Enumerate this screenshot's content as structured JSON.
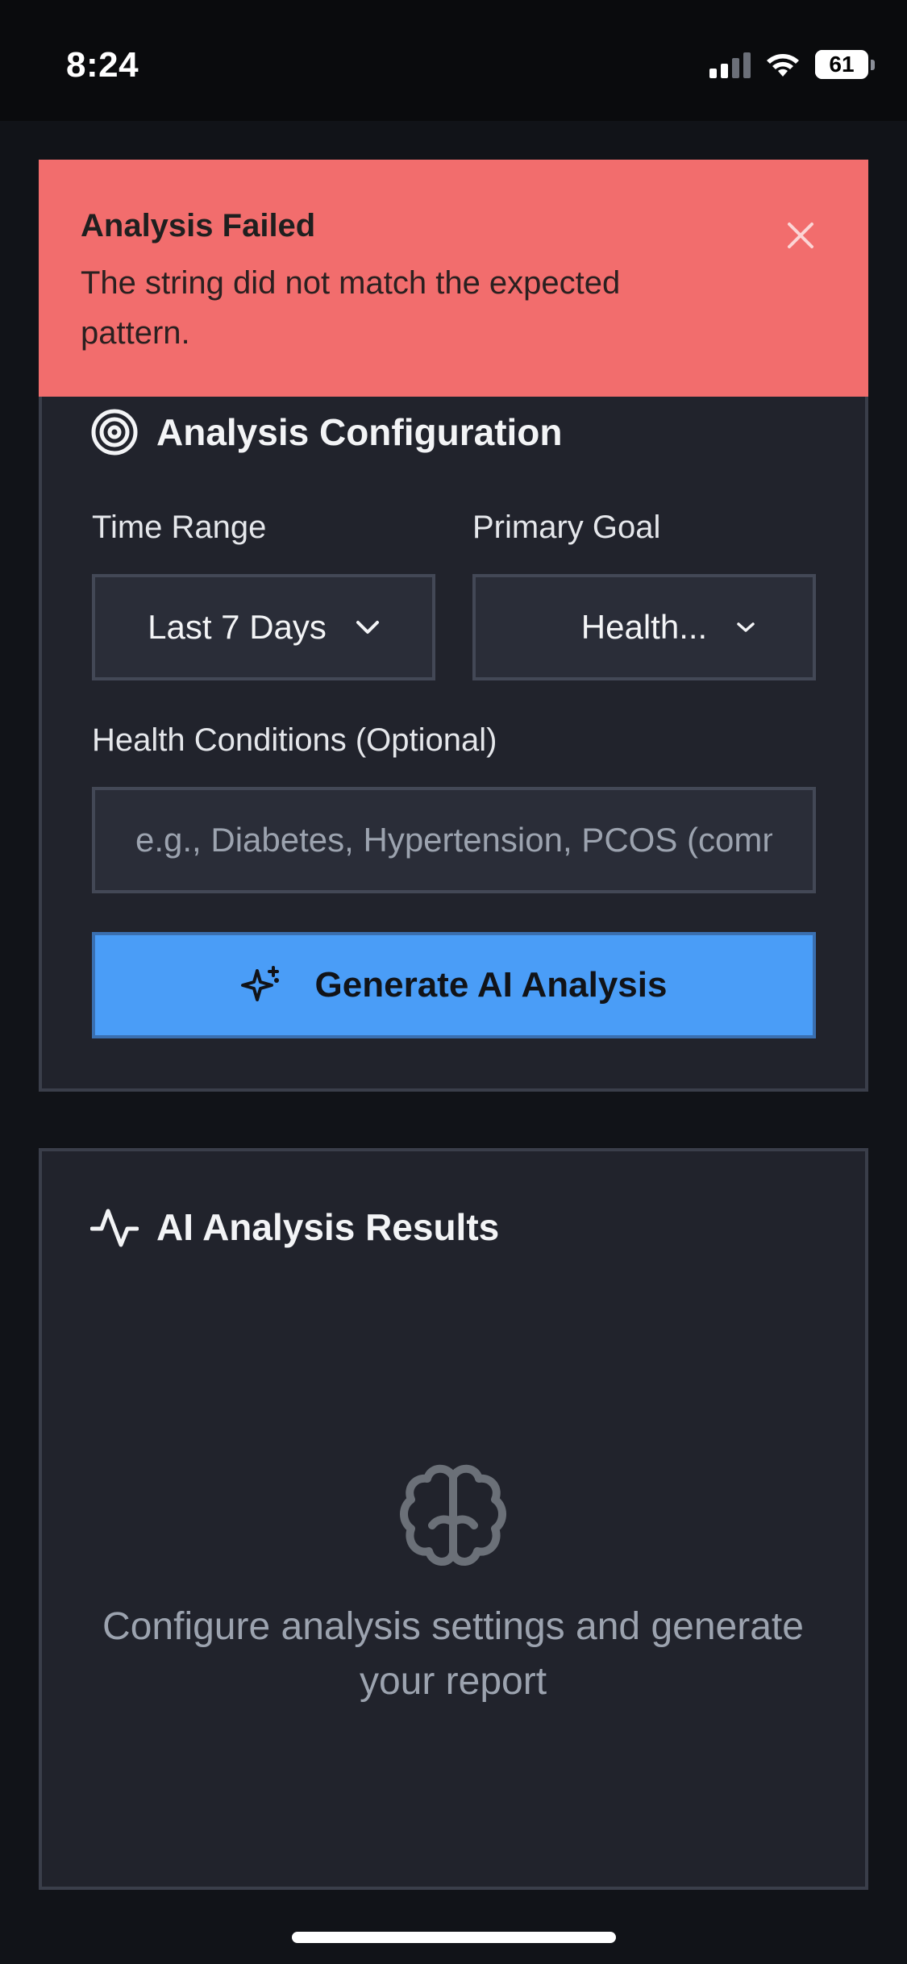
{
  "status_bar": {
    "time": "8:24",
    "battery": "61"
  },
  "toast": {
    "title": "Analysis Failed",
    "message": "The string did not match the expected pattern.",
    "close_icon": "close-icon",
    "color": "#f26d6d"
  },
  "config": {
    "title": "Analysis Configuration",
    "icon": "target-icon",
    "time_range": {
      "label": "Time Range",
      "value": "Last 7 Days"
    },
    "primary_goal": {
      "label": "Primary Goal",
      "value": "Health..."
    },
    "health_conditions": {
      "label": "Health Conditions (Optional)",
      "placeholder": "e.g., Diabetes, Hypertension, PCOS (comma separated)"
    },
    "generate_button": {
      "label": "Generate AI Analysis",
      "icon": "sparkles-icon",
      "color": "#4a9df7"
    }
  },
  "results": {
    "title": "AI Analysis Results",
    "icon": "activity-icon",
    "empty_icon": "brain-icon",
    "empty_text": "Configure analysis settings and generate your report"
  }
}
